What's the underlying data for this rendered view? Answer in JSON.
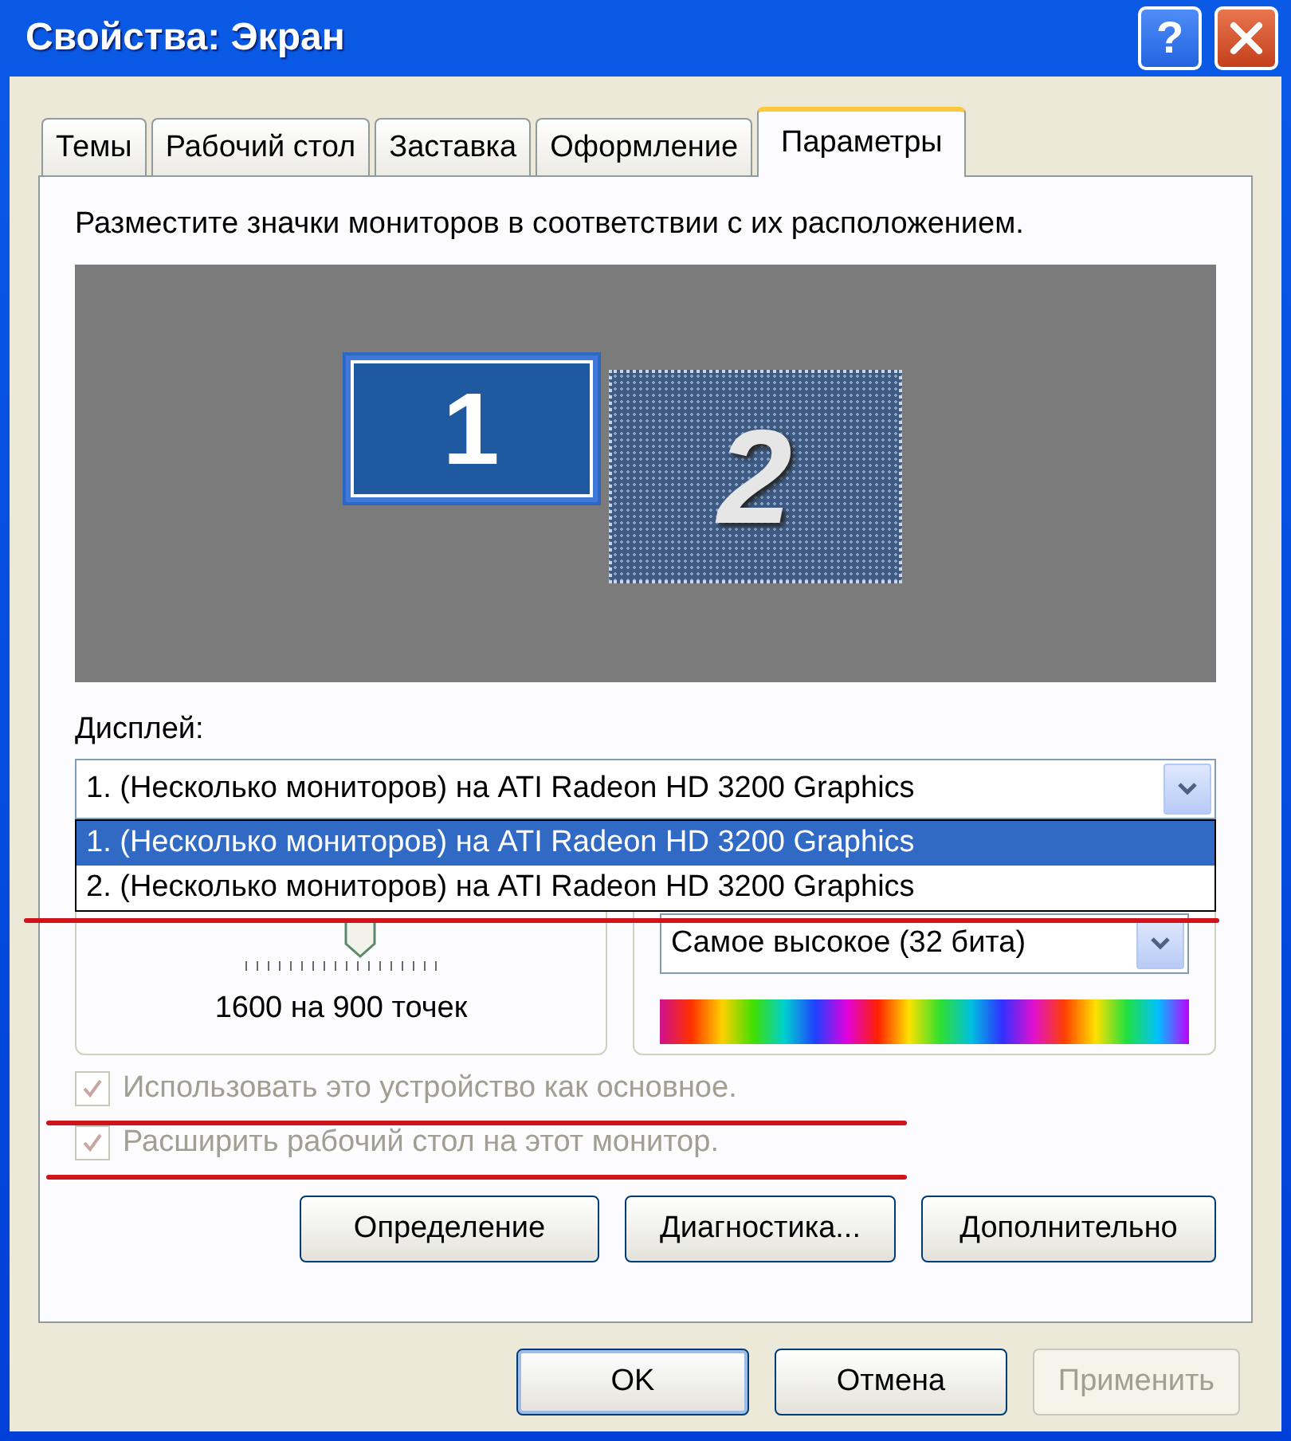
{
  "window": {
    "title": "Свойства: Экран",
    "help_button": "?"
  },
  "tabs": [
    {
      "label": "Темы",
      "selected": false
    },
    {
      "label": "Рабочий стол",
      "selected": false
    },
    {
      "label": "Заставка",
      "selected": false
    },
    {
      "label": "Оформление",
      "selected": false
    },
    {
      "label": "Параметры",
      "selected": true
    }
  ],
  "instruction": "Разместите значки мониторов в соответствии с их расположением.",
  "monitors": [
    {
      "label": "1",
      "selected": true
    },
    {
      "label": "2",
      "selected": false
    }
  ],
  "display": {
    "label": "Дисплей:",
    "value": "1. (Несколько мониторов) на ATI Radeon HD 3200 Graphics",
    "expanded": true,
    "annotation_underline": true,
    "options": [
      {
        "text": "1. (Несколько мониторов) на ATI Radeon HD 3200 Graphics",
        "selected": true
      },
      {
        "text": "2. (Несколько мониторов) на ATI Radeon HD 3200 Graphics",
        "selected": false
      }
    ]
  },
  "resolution": {
    "level": 0.6,
    "value": "1600 на 900 точек"
  },
  "color_quality": {
    "value": "Самое высокое (32 бита)"
  },
  "checkboxes": [
    {
      "label": "Использовать это устройство как основное.",
      "checked": true,
      "disabled": true,
      "annotation_underline": true
    },
    {
      "label": "Расширить рабочий стол на этот монитор.",
      "checked": true,
      "disabled": true,
      "annotation_underline": true
    }
  ],
  "buttons": [
    "Определение",
    "Диагностика...",
    "Дополнительно"
  ],
  "dialog_buttons": [
    {
      "label": "OK",
      "default": true,
      "disabled": false
    },
    {
      "label": "Отмена",
      "default": false,
      "disabled": false
    },
    {
      "label": "Применить",
      "default": false,
      "disabled": true
    }
  ]
}
